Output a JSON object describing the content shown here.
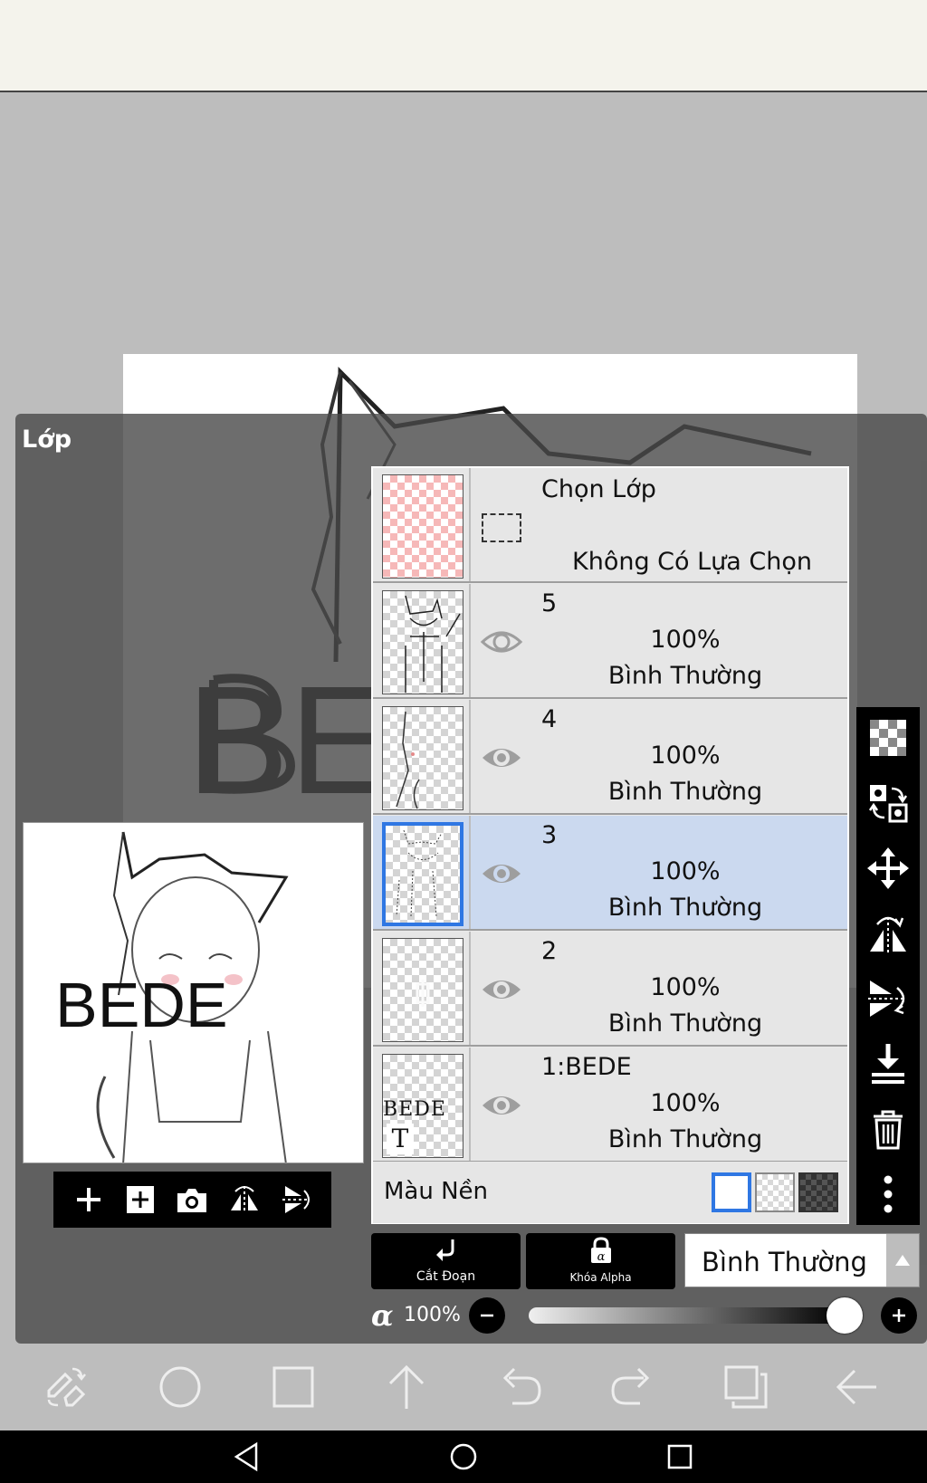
{
  "panel": {
    "title": "Lớp"
  },
  "selection_row": {
    "title": "Chọn Lớp",
    "subtitle": "Không Có Lựa Chọn"
  },
  "layers": [
    {
      "name": "5",
      "opacity": "100%",
      "mode": "Bình Thường",
      "visible": true,
      "selected": false
    },
    {
      "name": "4",
      "opacity": "100%",
      "mode": "Bình Thường",
      "visible": true,
      "selected": false
    },
    {
      "name": "3",
      "opacity": "100%",
      "mode": "Bình Thường",
      "visible": true,
      "selected": true
    },
    {
      "name": "2",
      "opacity": "100%",
      "mode": "Bình Thường",
      "visible": true,
      "selected": false
    },
    {
      "name": "1:BEDE",
      "opacity": "100%",
      "mode": "Bình Thường",
      "visible": true,
      "selected": false,
      "thumb_text": "BEDE",
      "thumb_type_icon": "T"
    }
  ],
  "background_color": {
    "label": "Màu Nền",
    "options": [
      "white",
      "transparent",
      "dark"
    ],
    "selected": "white"
  },
  "actions": {
    "clipping_label": "Cắt Đoạn",
    "alpha_lock_label": "Khóa Alpha",
    "blend_mode": "Bình Thường"
  },
  "opacity": {
    "symbol": "α",
    "value": "100%",
    "fraction": 1.0
  },
  "canvas_text": "BEDE",
  "preview_text": "BEDE",
  "colors": {
    "selected_row": "#cbd9ef",
    "selected_border": "#2f77e3",
    "panel_bg": "#484848",
    "toolbar_bg": "#000000"
  }
}
